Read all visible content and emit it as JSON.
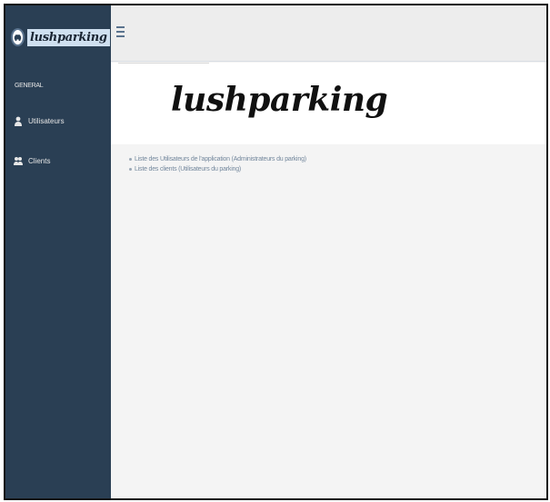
{
  "brand": {
    "name": "lushparking"
  },
  "sidebar": {
    "section_title": "GENERAL",
    "items": [
      {
        "label": "Utilisateurs",
        "icon": "user-icon"
      },
      {
        "label": "Clients",
        "icon": "users-icon"
      }
    ]
  },
  "header": {
    "menu_icon": "hamburger-icon"
  },
  "main": {
    "hero_title": "lushparking",
    "links": [
      {
        "label": "Liste des Utilisateurs de l'application (Administrateurs du parking)"
      },
      {
        "label": "Liste des clients (Utilisateurs du parking)"
      }
    ]
  },
  "colors": {
    "sidebar_bg": "#2a3f54",
    "content_bg": "#f4f4f4",
    "topbar_bg": "#ededed",
    "text_muted": "#73879c"
  }
}
